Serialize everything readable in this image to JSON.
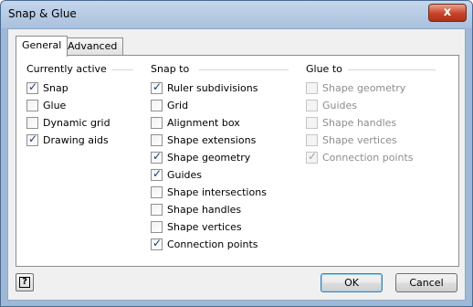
{
  "window": {
    "title": "Snap & Glue",
    "close_glyph": "x"
  },
  "tabs": [
    {
      "label": "General",
      "selected": true
    },
    {
      "label": "Advanced",
      "selected": false
    }
  ],
  "currently_active": {
    "title": "Currently active",
    "items": [
      {
        "label": "Snap",
        "checked": true
      },
      {
        "label": "Glue",
        "checked": false
      },
      {
        "label": "Dynamic grid",
        "checked": false
      },
      {
        "label": "Drawing aids",
        "checked": true
      }
    ]
  },
  "snap_to": {
    "title": "Snap to",
    "items": [
      {
        "label": "Ruler subdivisions",
        "checked": true
      },
      {
        "label": "Grid",
        "checked": false
      },
      {
        "label": "Alignment box",
        "checked": false
      },
      {
        "label": "Shape extensions",
        "checked": false
      },
      {
        "label": "Shape geometry",
        "checked": true
      },
      {
        "label": "Guides",
        "checked": true
      },
      {
        "label": "Shape intersections",
        "checked": false
      },
      {
        "label": "Shape handles",
        "checked": false
      },
      {
        "label": "Shape vertices",
        "checked": false
      },
      {
        "label": "Connection points",
        "checked": true
      }
    ]
  },
  "glue_to": {
    "title": "Glue to",
    "items": [
      {
        "label": "Shape geometry",
        "checked": false,
        "enabled": false
      },
      {
        "label": "Guides",
        "checked": false,
        "enabled": false
      },
      {
        "label": "Shape handles",
        "checked": false,
        "enabled": false
      },
      {
        "label": "Shape vertices",
        "checked": false,
        "enabled": false
      },
      {
        "label": "Connection points",
        "checked": true,
        "enabled": false
      }
    ]
  },
  "footer": {
    "help_glyph": "?",
    "ok_label": "OK",
    "cancel_label": "Cancel"
  },
  "colors": {
    "title_bar": "#a9c0dd",
    "close_button": "#c7432a",
    "check": "#1d3a74"
  }
}
